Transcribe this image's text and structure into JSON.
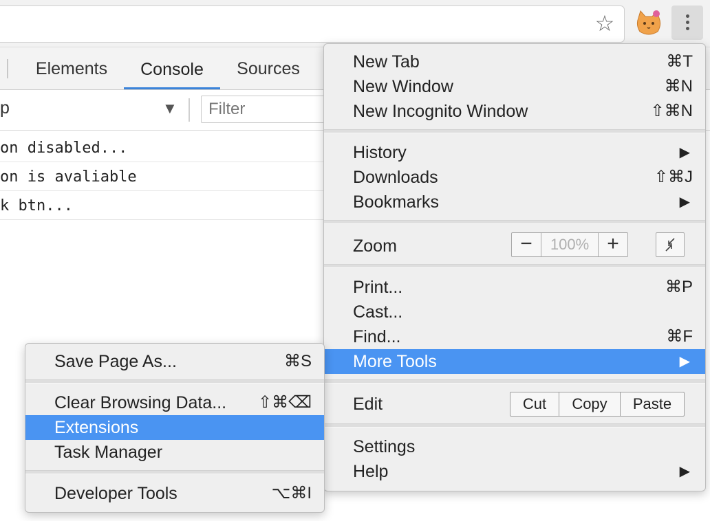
{
  "console": {
    "tabs": [
      {
        "label": "Elements"
      },
      {
        "label": "Console"
      },
      {
        "label": "Sources"
      }
    ],
    "context_text": "p",
    "filter_placeholder": "Filter",
    "lines": [
      "on disabled...",
      "on is avaliable",
      "k btn..."
    ]
  },
  "main_menu": {
    "new_tab": {
      "label": "New Tab",
      "shortcut": "⌘T"
    },
    "new_window": {
      "label": "New Window",
      "shortcut": "⌘N"
    },
    "new_incognito": {
      "label": "New Incognito Window",
      "shortcut": "⇧⌘N"
    },
    "history": {
      "label": "History",
      "arrow": "▶"
    },
    "downloads": {
      "label": "Downloads",
      "shortcut": "⇧⌘J"
    },
    "bookmarks": {
      "label": "Bookmarks",
      "arrow": "▶"
    },
    "zoom": {
      "label": "Zoom",
      "minus": "−",
      "value": "100%",
      "plus": "+"
    },
    "print": {
      "label": "Print...",
      "shortcut": "⌘P"
    },
    "cast": {
      "label": "Cast..."
    },
    "find": {
      "label": "Find...",
      "shortcut": "⌘F"
    },
    "more_tools": {
      "label": "More Tools",
      "arrow": "▶"
    },
    "edit": {
      "label": "Edit",
      "cut": "Cut",
      "copy": "Copy",
      "paste": "Paste"
    },
    "settings": {
      "label": "Settings"
    },
    "help": {
      "label": "Help",
      "arrow": "▶"
    }
  },
  "sub_menu": {
    "save_page": {
      "label": "Save Page As...",
      "shortcut": "⌘S"
    },
    "clear_data": {
      "label": "Clear Browsing Data...",
      "shortcut": "⇧⌘⌫"
    },
    "extensions": {
      "label": "Extensions"
    },
    "task_manager": {
      "label": "Task Manager"
    },
    "developer_tools": {
      "label": "Developer Tools",
      "shortcut": "⌥⌘I"
    }
  },
  "icons": {
    "bookmark": "star-icon",
    "extension": "cat-extension-icon",
    "menu": "kebab-menu-icon",
    "fullscreen": "fullscreen-icon",
    "dropdown": "dropdown-arrow-icon"
  },
  "colors": {
    "highlight": "#4a94f2",
    "active_tab": "#3b83d9",
    "menu_bg": "#efefef"
  }
}
